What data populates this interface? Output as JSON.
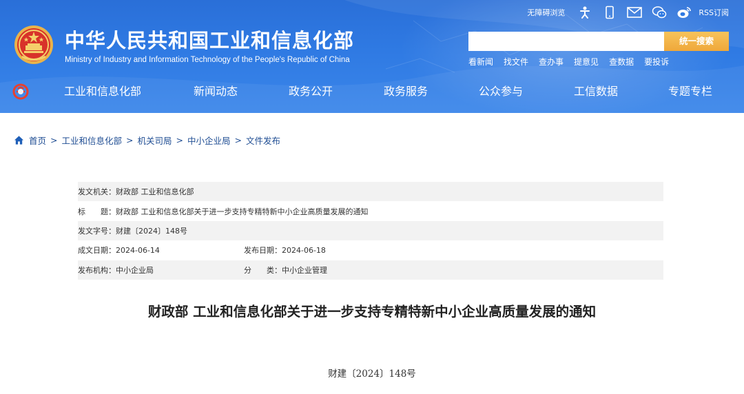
{
  "header": {
    "title_cn": "中华人民共和国工业和信息化部",
    "title_en": "Ministry of Industry and Information Technology of the People's Republic of China",
    "toplinks": {
      "accessible": "无障碍浏览",
      "rss": "RSS订阅",
      "icons": [
        "accessibility-person-icon",
        "mobile-phone-icon",
        "mail-icon",
        "wechat-icon",
        "weibo-icon"
      ]
    },
    "search": {
      "placeholder": "",
      "value": "",
      "button": "统一搜索"
    },
    "quick_links": [
      "看新闻",
      "找文件",
      "查办事",
      "提意见",
      "查数据",
      "要投诉"
    ],
    "nav": [
      "工业和信息化部",
      "新闻动态",
      "政务公开",
      "政务服务",
      "公众参与",
      "工信数据",
      "专题专栏"
    ],
    "colors": {
      "header_blue": "#2f7ae3",
      "search_button": "#efa83a"
    }
  },
  "breadcrumb": [
    "首页",
    "工业和信息化部",
    "机关司局",
    "中小企业局",
    "文件发布"
  ],
  "meta": {
    "issuer_label": "发文机关：",
    "issuer": "财政部 工业和信息化部",
    "title_label": "标　　题：",
    "title": "财政部 工业和信息化部关于进一步支持专精特新中小企业高质量发展的通知",
    "doc_no_label": "发文字号：",
    "doc_no": "财建〔2024〕148号",
    "created_label": "成文日期：",
    "created": "2024-06-14",
    "published_label": "发布日期：",
    "published": "2024-06-18",
    "agency_label": "发布机构：",
    "agency": "中小企业局",
    "category_label": "分　　类：",
    "category": "中小企业管理"
  },
  "article": {
    "title": "财政部 工业和信息化部关于进一步支持专精特新中小企业高质量发展的通知",
    "doc_no": "财建〔2024〕148号"
  }
}
